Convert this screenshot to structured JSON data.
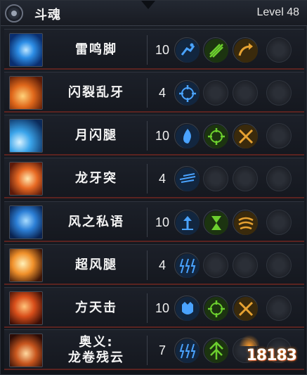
{
  "header": {
    "title": "斗魂",
    "level": "Level 48"
  },
  "skills": [
    {
      "name": "雷鸣脚",
      "level": "10",
      "icon": "lightning-kick-icon",
      "runes": [
        "dash-run-icon",
        "green-slash-icon",
        "arrow-curve-icon"
      ]
    },
    {
      "name": "闪裂乱牙",
      "level": "4",
      "icon": "fire-fist-icon",
      "runes": [
        "target-blue-icon"
      ]
    },
    {
      "name": "月闪腿",
      "level": "10",
      "icon": "crescent-kick-icon",
      "runes": [
        "blue-flame-icon",
        "target-green-icon",
        "crossed-blades-icon"
      ]
    },
    {
      "name": "龙牙突",
      "level": "4",
      "icon": "spiral-fire-icon",
      "runes": [
        "speed-streak-icon"
      ]
    },
    {
      "name": "风之私语",
      "level": "10",
      "icon": "wind-whisper-icon",
      "runes": [
        "jump-arrow-icon",
        "hourglass-down-icon",
        "wind-swirl-icon"
      ]
    },
    {
      "name": "超风腿",
      "level": "4",
      "icon": "burst-kick-icon",
      "runes": [
        "triple-bolt-icon"
      ]
    },
    {
      "name": "方天击",
      "level": "10",
      "icon": "fire-strike-icon",
      "runes": [
        "beast-head-icon",
        "target-green-icon",
        "crossed-blades-icon"
      ]
    },
    {
      "name": "奥义:\n龙卷残云",
      "level": "7",
      "icon": "tornado-icon",
      "runes": [
        "triple-bolt-icon",
        "green-burst-icon"
      ]
    }
  ],
  "watermark": "18183",
  "colors": {
    "row_border": "#5a2320",
    "blue_rune": "#4aa3ff",
    "green_rune": "#6ccf2e",
    "gold_rune": "#e6a232"
  }
}
